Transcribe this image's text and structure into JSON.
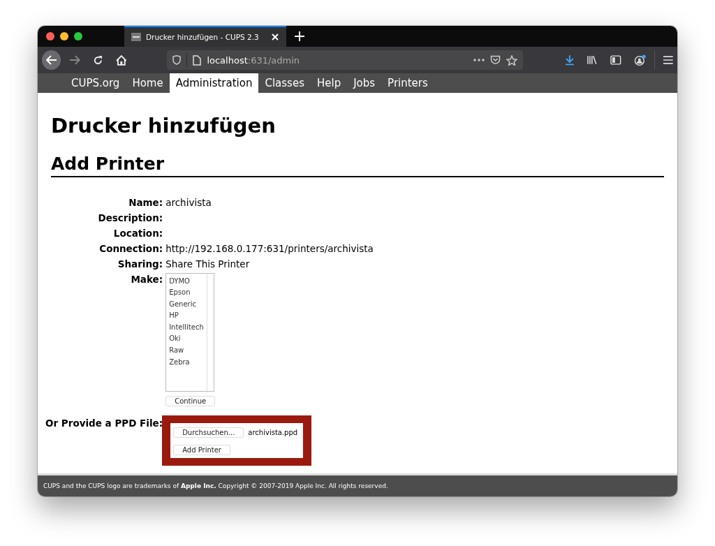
{
  "browser": {
    "tab_title": "Drucker hinzufügen - CUPS 2.3",
    "url_host": "localhost",
    "url_path": ":631/admin"
  },
  "nav": [
    {
      "label": "CUPS.org",
      "selected": false
    },
    {
      "label": "Home",
      "selected": false
    },
    {
      "label": "Administration",
      "selected": true
    },
    {
      "label": "Classes",
      "selected": false
    },
    {
      "label": "Help",
      "selected": false
    },
    {
      "label": "Jobs",
      "selected": false
    },
    {
      "label": "Printers",
      "selected": false
    }
  ],
  "page_title": "Drucker hinzufügen",
  "section_title": "Add Printer",
  "fields": [
    {
      "label": "Name:",
      "value": "archivista"
    },
    {
      "label": "Description:"
    },
    {
      "label": "Location:"
    },
    {
      "label": "Connection:",
      "value": "http://192.168.0.177:631/printers/archivista"
    },
    {
      "label": "Sharing:",
      "value": "Share This Printer"
    }
  ],
  "make": {
    "label": "Make:",
    "options": [
      "DYMO",
      "Epson",
      "Generic",
      "HP",
      "Intellitech",
      "Oki",
      "Raw",
      "Zebra"
    ],
    "button": "Continue"
  },
  "ppd": {
    "label": "Or Provide a PPD File:",
    "browse_button": "Durchsuchen...",
    "file_name": "archivista.ppd",
    "button": "Add Printer"
  },
  "footer": "CUPS and the CUPS logo are trademarks of **Apple Inc.** Copyright © 2007-2019 Apple Inc. All rights reserved."
}
